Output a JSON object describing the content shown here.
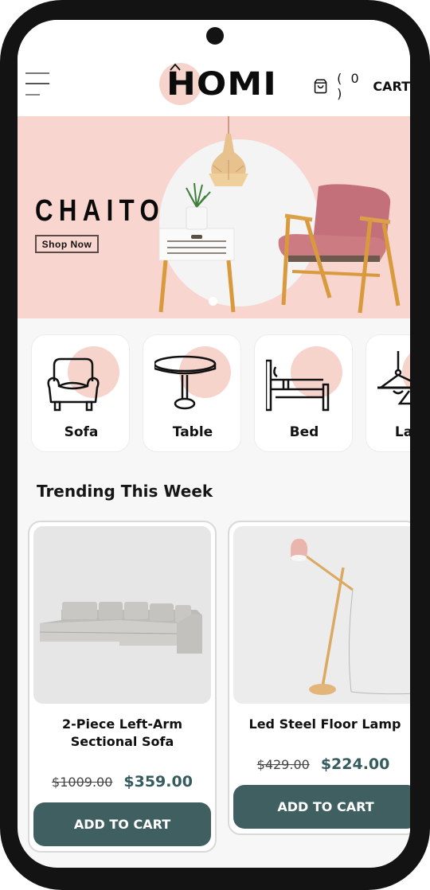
{
  "header": {
    "logo_text": "HOMI",
    "cart_count": "( 0 )",
    "cart_label": "CART"
  },
  "banner": {
    "title": "CHAITO",
    "cta_label": "Shop Now",
    "active_slide": 1,
    "total_slides": 1
  },
  "categories": [
    {
      "label": "Sofa",
      "icon": "armchair-icon"
    },
    {
      "label": "Table",
      "icon": "round-table-icon"
    },
    {
      "label": "Bed",
      "icon": "bed-icon"
    },
    {
      "label": "Lamp",
      "icon": "pendant-lamp-icon"
    }
  ],
  "trending": {
    "title": "Trending This Week",
    "products": [
      {
        "name": "2-Piece Left-Arm Sectional Sofa",
        "old_price": "$1009.00",
        "price": "$359.00",
        "button_label": "ADD TO CART"
      },
      {
        "name": "Led Steel Floor Lamp",
        "old_price": "$429.00",
        "price": "$224.00",
        "button_label": "ADD TO CART"
      }
    ]
  },
  "colors": {
    "accent_pink": "#f8d6cf",
    "button_teal": "#405f61",
    "price_teal": "#355b5e"
  }
}
